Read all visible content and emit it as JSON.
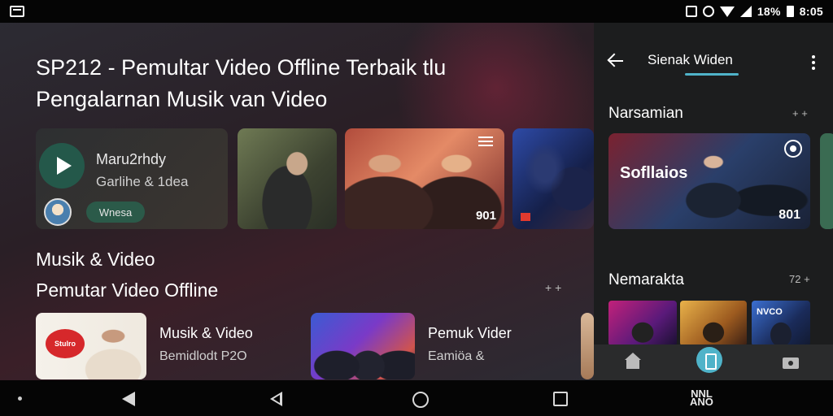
{
  "status_bar": {
    "battery_text": "18%",
    "time": "8:05"
  },
  "main": {
    "title": "SP212 - Pemultar Video Offline Terbaik  tlu Pengalarnan Musik van Video",
    "hero": {
      "title": "Maru2rhdy",
      "subtitle": "Garlihe & 1dea",
      "button_label": "Wnesa"
    },
    "thumbs": [
      {
        "number": ""
      },
      {
        "number": "901"
      },
      {
        "number": ""
      }
    ],
    "section_title_1": "Musik & Video",
    "section_title_2": "Pemutar Video Offline",
    "section_more": "+ +",
    "row_items": [
      {
        "title": "Musik & Video",
        "subtitle": "Bemidlodt P2O",
        "logo_text": "Stulro"
      },
      {
        "title": "Pemuk Vider",
        "subtitle": "Eamiöa &"
      }
    ]
  },
  "panel": {
    "tab_label": "Sienak Widen",
    "section_1": {
      "title": "Narsamian",
      "more": "+ +"
    },
    "featured": {
      "title": "Sofllaios",
      "number": "801"
    },
    "section_2": {
      "title": "Nemarakta",
      "more": "72 +"
    },
    "mini_thumb_label": "NVCO"
  },
  "system_nav": {
    "label_top": "NNL",
    "label_bottom": "ANO"
  },
  "colors": {
    "accent": "#4fb3c9",
    "green_button": "#2b5a49",
    "panel_bg": "#1c1d1e"
  }
}
